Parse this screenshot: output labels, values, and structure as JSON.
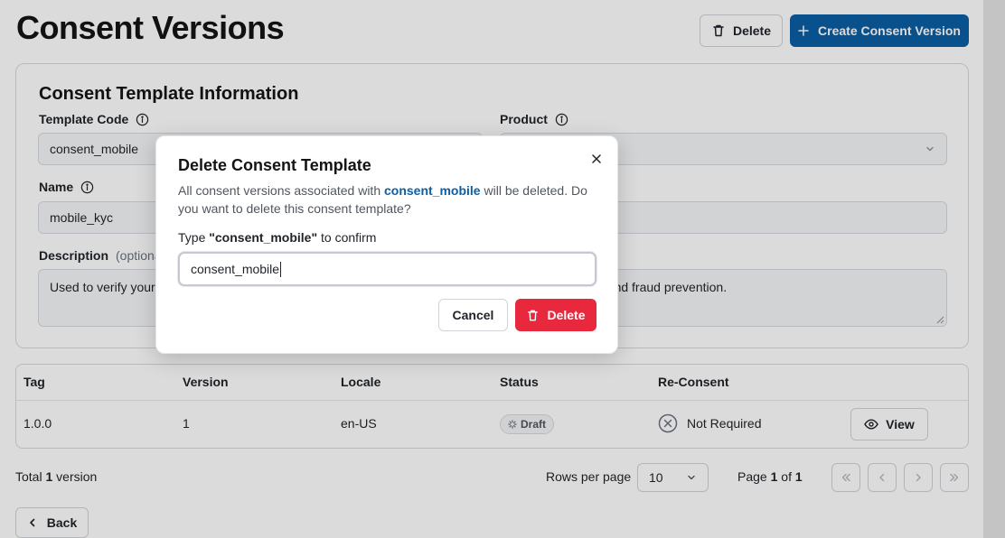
{
  "header": {
    "title": "Consent Versions",
    "delete_label": "Delete",
    "create_label": "Create Consent Version"
  },
  "info_card": {
    "title": "Consent Template Information",
    "template_code_label": "Template Code",
    "template_code_value": "consent_mobile",
    "product_label": "Product",
    "name_label": "Name",
    "name_value": "mobile_kyc",
    "description_label": "Description",
    "description_optional": "(optiona",
    "description_value_left": "Used to verify your",
    "description_value_right": "ty and fraud prevention."
  },
  "table": {
    "headers": [
      "Tag",
      "Version",
      "Locale",
      "Status",
      "Re-Consent"
    ],
    "rows": [
      {
        "tag": "1.0.0",
        "version": "1",
        "locale": "en-US",
        "status": "Draft",
        "reconsent": "Not Required",
        "action": "View"
      }
    ]
  },
  "footer": {
    "total_prefix": "Total",
    "total_count": "1",
    "total_suffix": "version",
    "rows_per_page_label": "Rows per page",
    "rows_per_page_value": "10",
    "page_prefix": "Page",
    "page_current": "1",
    "page_of": "of",
    "page_total": "1",
    "back_label": "Back"
  },
  "modal": {
    "title": "Delete Consent Template",
    "desc_prefix": "All consent versions associated with",
    "desc_highlight": "consent_mobile",
    "desc_suffix": "will be deleted. Do you want to delete this consent template?",
    "confirm_prefix": "Type ",
    "confirm_keyword": "\"consent_mobile\"",
    "confirm_suffix": " to confirm",
    "input_value": "consent_mobile",
    "cancel_label": "Cancel",
    "delete_label": "Delete"
  },
  "colors": {
    "primary": "#0b5fa5",
    "danger": "#e8283c",
    "border": "#d6dae0",
    "input_bg": "#f5f6f8"
  },
  "icons": {
    "header_delete": "trash-icon",
    "header_create": "plus-icon",
    "info": "info-icon",
    "select": "chevron-down-icon",
    "status": "spinner-icon",
    "reconsent": "x-circle-icon",
    "view": "eye-icon",
    "close": "close-icon",
    "back": "chevron-left-icon"
  }
}
